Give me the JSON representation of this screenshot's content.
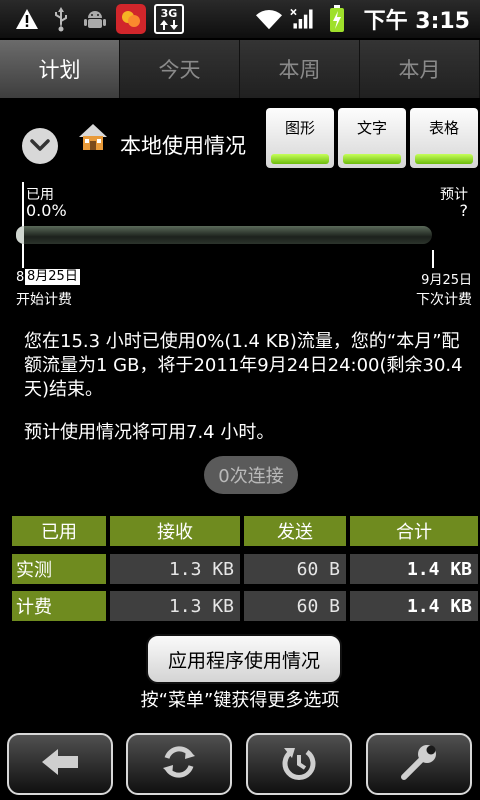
{
  "status_bar": {
    "icons": [
      "warning-icon",
      "usb-icon",
      "android-debug-icon",
      "app-notification-icon",
      "3g-icon",
      "wifi-icon",
      "signal-icon",
      "battery-charging-icon"
    ],
    "network_label": "3G",
    "time": "下午 3:15"
  },
  "tabs": [
    {
      "label": "计划",
      "active": true
    },
    {
      "label": "今天",
      "active": false
    },
    {
      "label": "本周",
      "active": false
    },
    {
      "label": "本月",
      "active": false
    }
  ],
  "header": {
    "title": "本地使用情况",
    "view_buttons": [
      "图形",
      "文字",
      "表格"
    ]
  },
  "usage_bar": {
    "used_label": "已用",
    "used_value": "0.0%",
    "projected_label": "预计",
    "projected_value": "?",
    "fill_fraction": 0.0,
    "start_tick": "8",
    "start_date": "8月25日",
    "start_label": "开始计费",
    "end_date": "9月25日",
    "end_label": "下次计费"
  },
  "summary": {
    "text": "您在15.3 小时已使用0%(1.4 KB)流量，您的“本月”配额流量为1 GB，将于2011年9月24日24:00(剩余30.4 天)结束。",
    "forecast": "预计使用情况将可用7.4 小时。",
    "connections_button": "0次连接"
  },
  "table": {
    "headers": [
      "已用",
      "接收",
      "发送",
      "合计"
    ],
    "rows": [
      {
        "label": "实测",
        "received": "1.3 KB",
        "sent": "60 B",
        "total": "1.4 KB"
      },
      {
        "label": "计费",
        "received": "1.3 KB",
        "sent": "60 B",
        "total": "1.4 KB"
      }
    ]
  },
  "app_usage_button": "应用程序使用情况",
  "menu_hint": "按“菜单”键获得更多选项",
  "bottom_bar": {
    "buttons": [
      "back-arrow-icon",
      "refresh-icon",
      "reset-icon",
      "wrench-icon"
    ]
  },
  "colors": {
    "accent_green": "#6f8b1f",
    "bar_green": "#8fdc2a"
  }
}
